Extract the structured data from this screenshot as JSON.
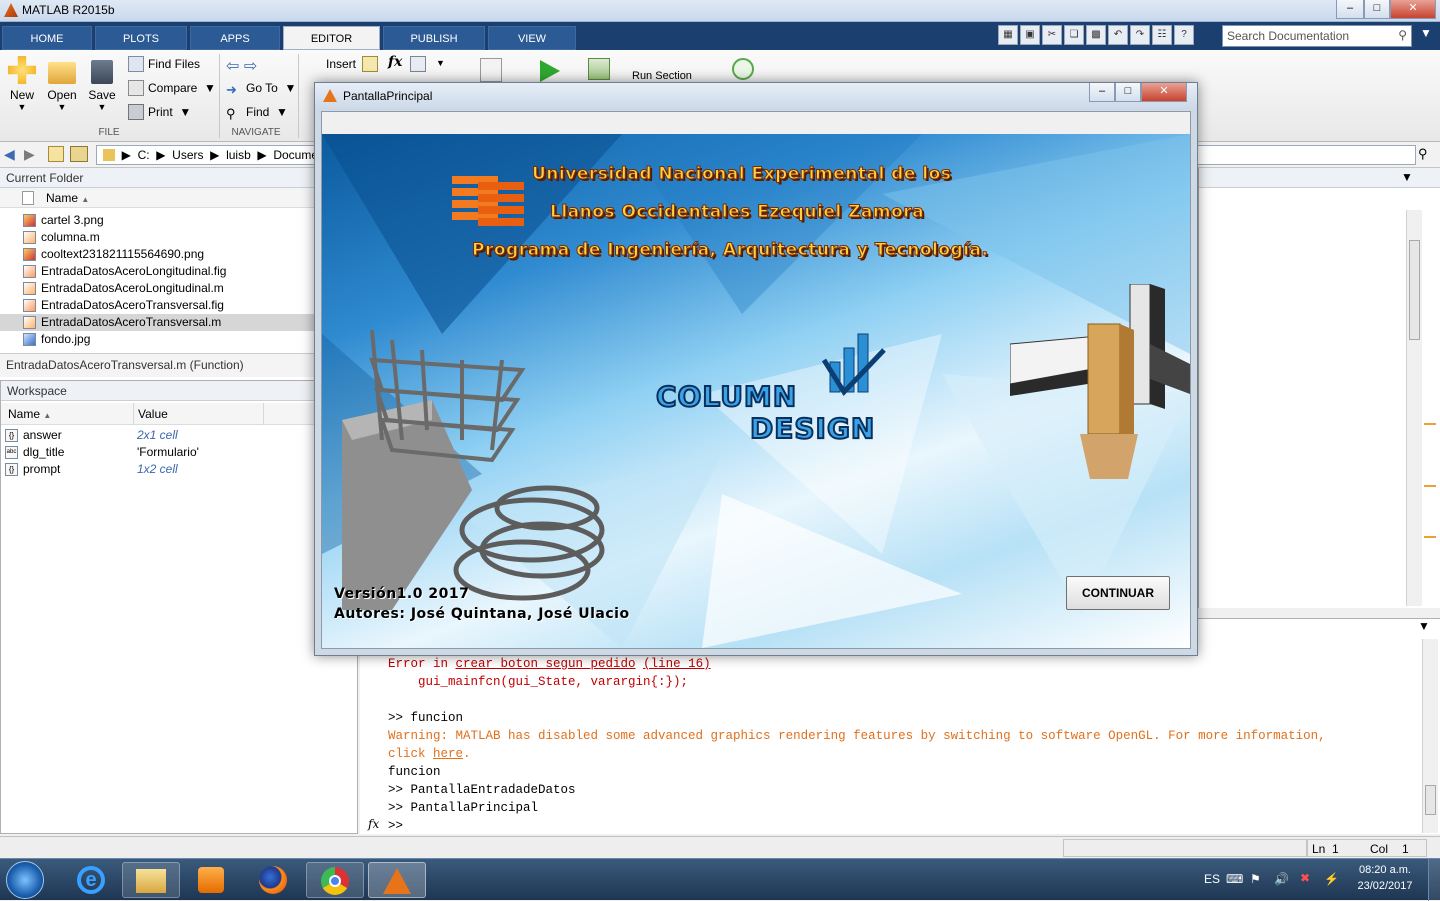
{
  "app": {
    "title": "MATLAB R2015b"
  },
  "tabs": [
    "HOME",
    "PLOTS",
    "APPS",
    "EDITOR",
    "PUBLISH",
    "VIEW"
  ],
  "active_tab": "EDITOR",
  "search": {
    "placeholder": "Search Documentation"
  },
  "ribbon": {
    "new": "New",
    "open": "Open",
    "save": "Save",
    "find_files": "Find Files",
    "compare": "Compare",
    "print": "Print",
    "go_to": "Go To",
    "find": "Find",
    "insert": "Insert",
    "fx": "fx",
    "run_section": "Run Section",
    "group_file": "FILE",
    "group_navigate": "NAVIGATE"
  },
  "address": {
    "parts": [
      "C:",
      "Users",
      "luisb",
      "Documen"
    ]
  },
  "current_folder": {
    "title": "Current Folder",
    "col_name": "Name",
    "files": [
      {
        "name": "cartel 3.png",
        "type": "png"
      },
      {
        "name": "columna.m",
        "type": "m"
      },
      {
        "name": "cooltext231821115564690.png",
        "type": "png"
      },
      {
        "name": "EntradaDatosAceroLongitudinal.fig",
        "type": "fig"
      },
      {
        "name": "EntradaDatosAceroLongitudinal.m",
        "type": "m"
      },
      {
        "name": "EntradaDatosAceroTransversal.fig",
        "type": "fig"
      },
      {
        "name": "EntradaDatosAceroTransversal.m",
        "type": "m",
        "selected": true
      },
      {
        "name": "fondo.jpg",
        "type": "jpg"
      }
    ],
    "detail": "EntradaDatosAceroTransversal.m  (Function)"
  },
  "workspace": {
    "title": "Workspace",
    "col_name": "Name",
    "col_value": "Value",
    "vars": [
      {
        "icon": "{}",
        "name": "answer",
        "value": "2x1 cell"
      },
      {
        "icon": "abc",
        "name": "dlg_title",
        "value": "'Formulario'"
      },
      {
        "icon": "{}",
        "name": "prompt",
        "value": "1x2 cell"
      }
    ]
  },
  "command_window": {
    "error_prefix": "Error in ",
    "error_fn": "crear_boton_segun_pedido",
    "error_line": "(line 16)",
    "line2": "    gui_mainfcn(gui_State, varargin{:});",
    "line3": ">> funcion",
    "warning1": "Warning: MATLAB has disabled some advanced graphics rendering features by switching to software OpenGL. For more information,",
    "warning2_pre": "click ",
    "warning2_link": "here",
    "warning2_post": ".",
    "line5": "funcion",
    "line6": ">> PantallaEntradadeDatos",
    "line7": ">> PantallaPrincipal",
    "prompt": ">>",
    "fx": "fx"
  },
  "status": {
    "ln_label": "Ln",
    "ln": "1",
    "col_label": "Col",
    "col": "1"
  },
  "dialog": {
    "title": "PantallaPrincipal",
    "university_line1": "Universidad Nacional Experimental de los",
    "university_line2": "Llanos Occidentales Ezequiel Zamora",
    "program": "Programa de Ingeniería, Arquitectura y Tecnología.",
    "logo_line1": "COLUMN",
    "logo_line2": "DESIGN",
    "version": "Versión1.0 2017",
    "authors": "Autores: José Quintana, José Ulacio",
    "continue_button": "CONTINUAR"
  },
  "taskbar": {
    "lang": "ES",
    "time": "08:20 a.m.",
    "date": "23/02/2017"
  },
  "colors": {
    "tab_bg": "#1b3f6e",
    "error": "#c00000",
    "warning": "#e0701c",
    "accent_orange": "#f47a1f",
    "logo_blue": "#1d6fb8"
  }
}
